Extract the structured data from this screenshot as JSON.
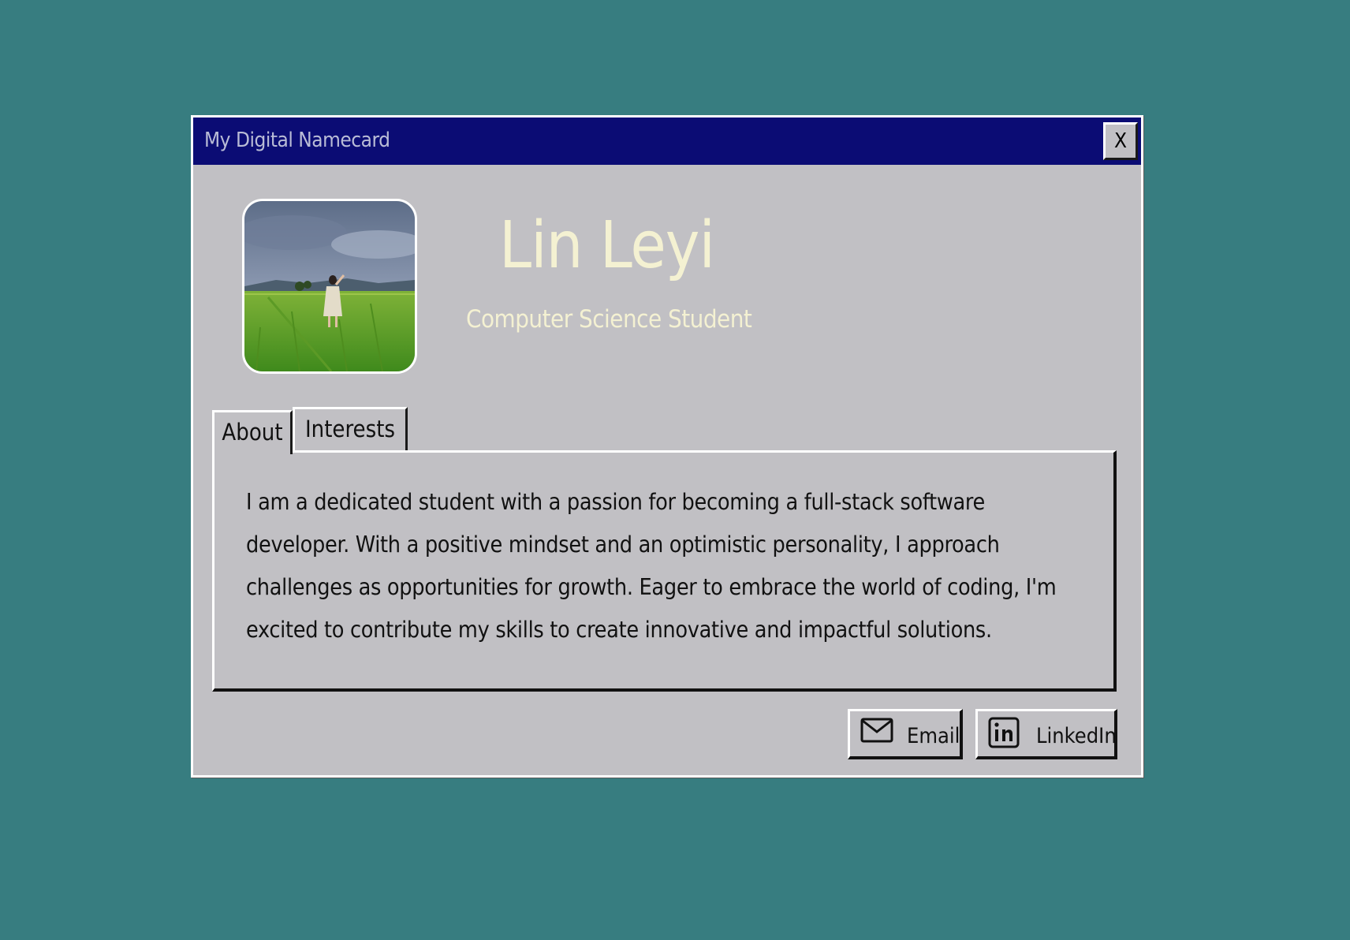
{
  "colors": {
    "desktop": "#377d80",
    "titlebar": "#0b0c74",
    "window": "#c1c0c4",
    "name_text": "#f4f1d2"
  },
  "window": {
    "title": "My Digital Namecard",
    "close_label": "X"
  },
  "profile": {
    "name": "Lin Leyi",
    "subtitle": "Computer Science Student",
    "avatar_icon": "profile-photo"
  },
  "tabs": [
    {
      "label": "About",
      "active": true
    },
    {
      "label": "Interests",
      "active": false
    }
  ],
  "about": {
    "text": "I am a dedicated student with a passion for becoming a full-stack software developer. With a positive mindset and an optimistic personality, I approach challenges as opportunities for growth. Eager to embrace the world of coding, I'm excited to contribute my skills to create innovative and impactful solutions."
  },
  "buttons": {
    "email": {
      "label": "Email",
      "icon": "envelope-icon"
    },
    "linkedin": {
      "label": "LinkedIn",
      "icon": "linkedin-icon"
    }
  }
}
